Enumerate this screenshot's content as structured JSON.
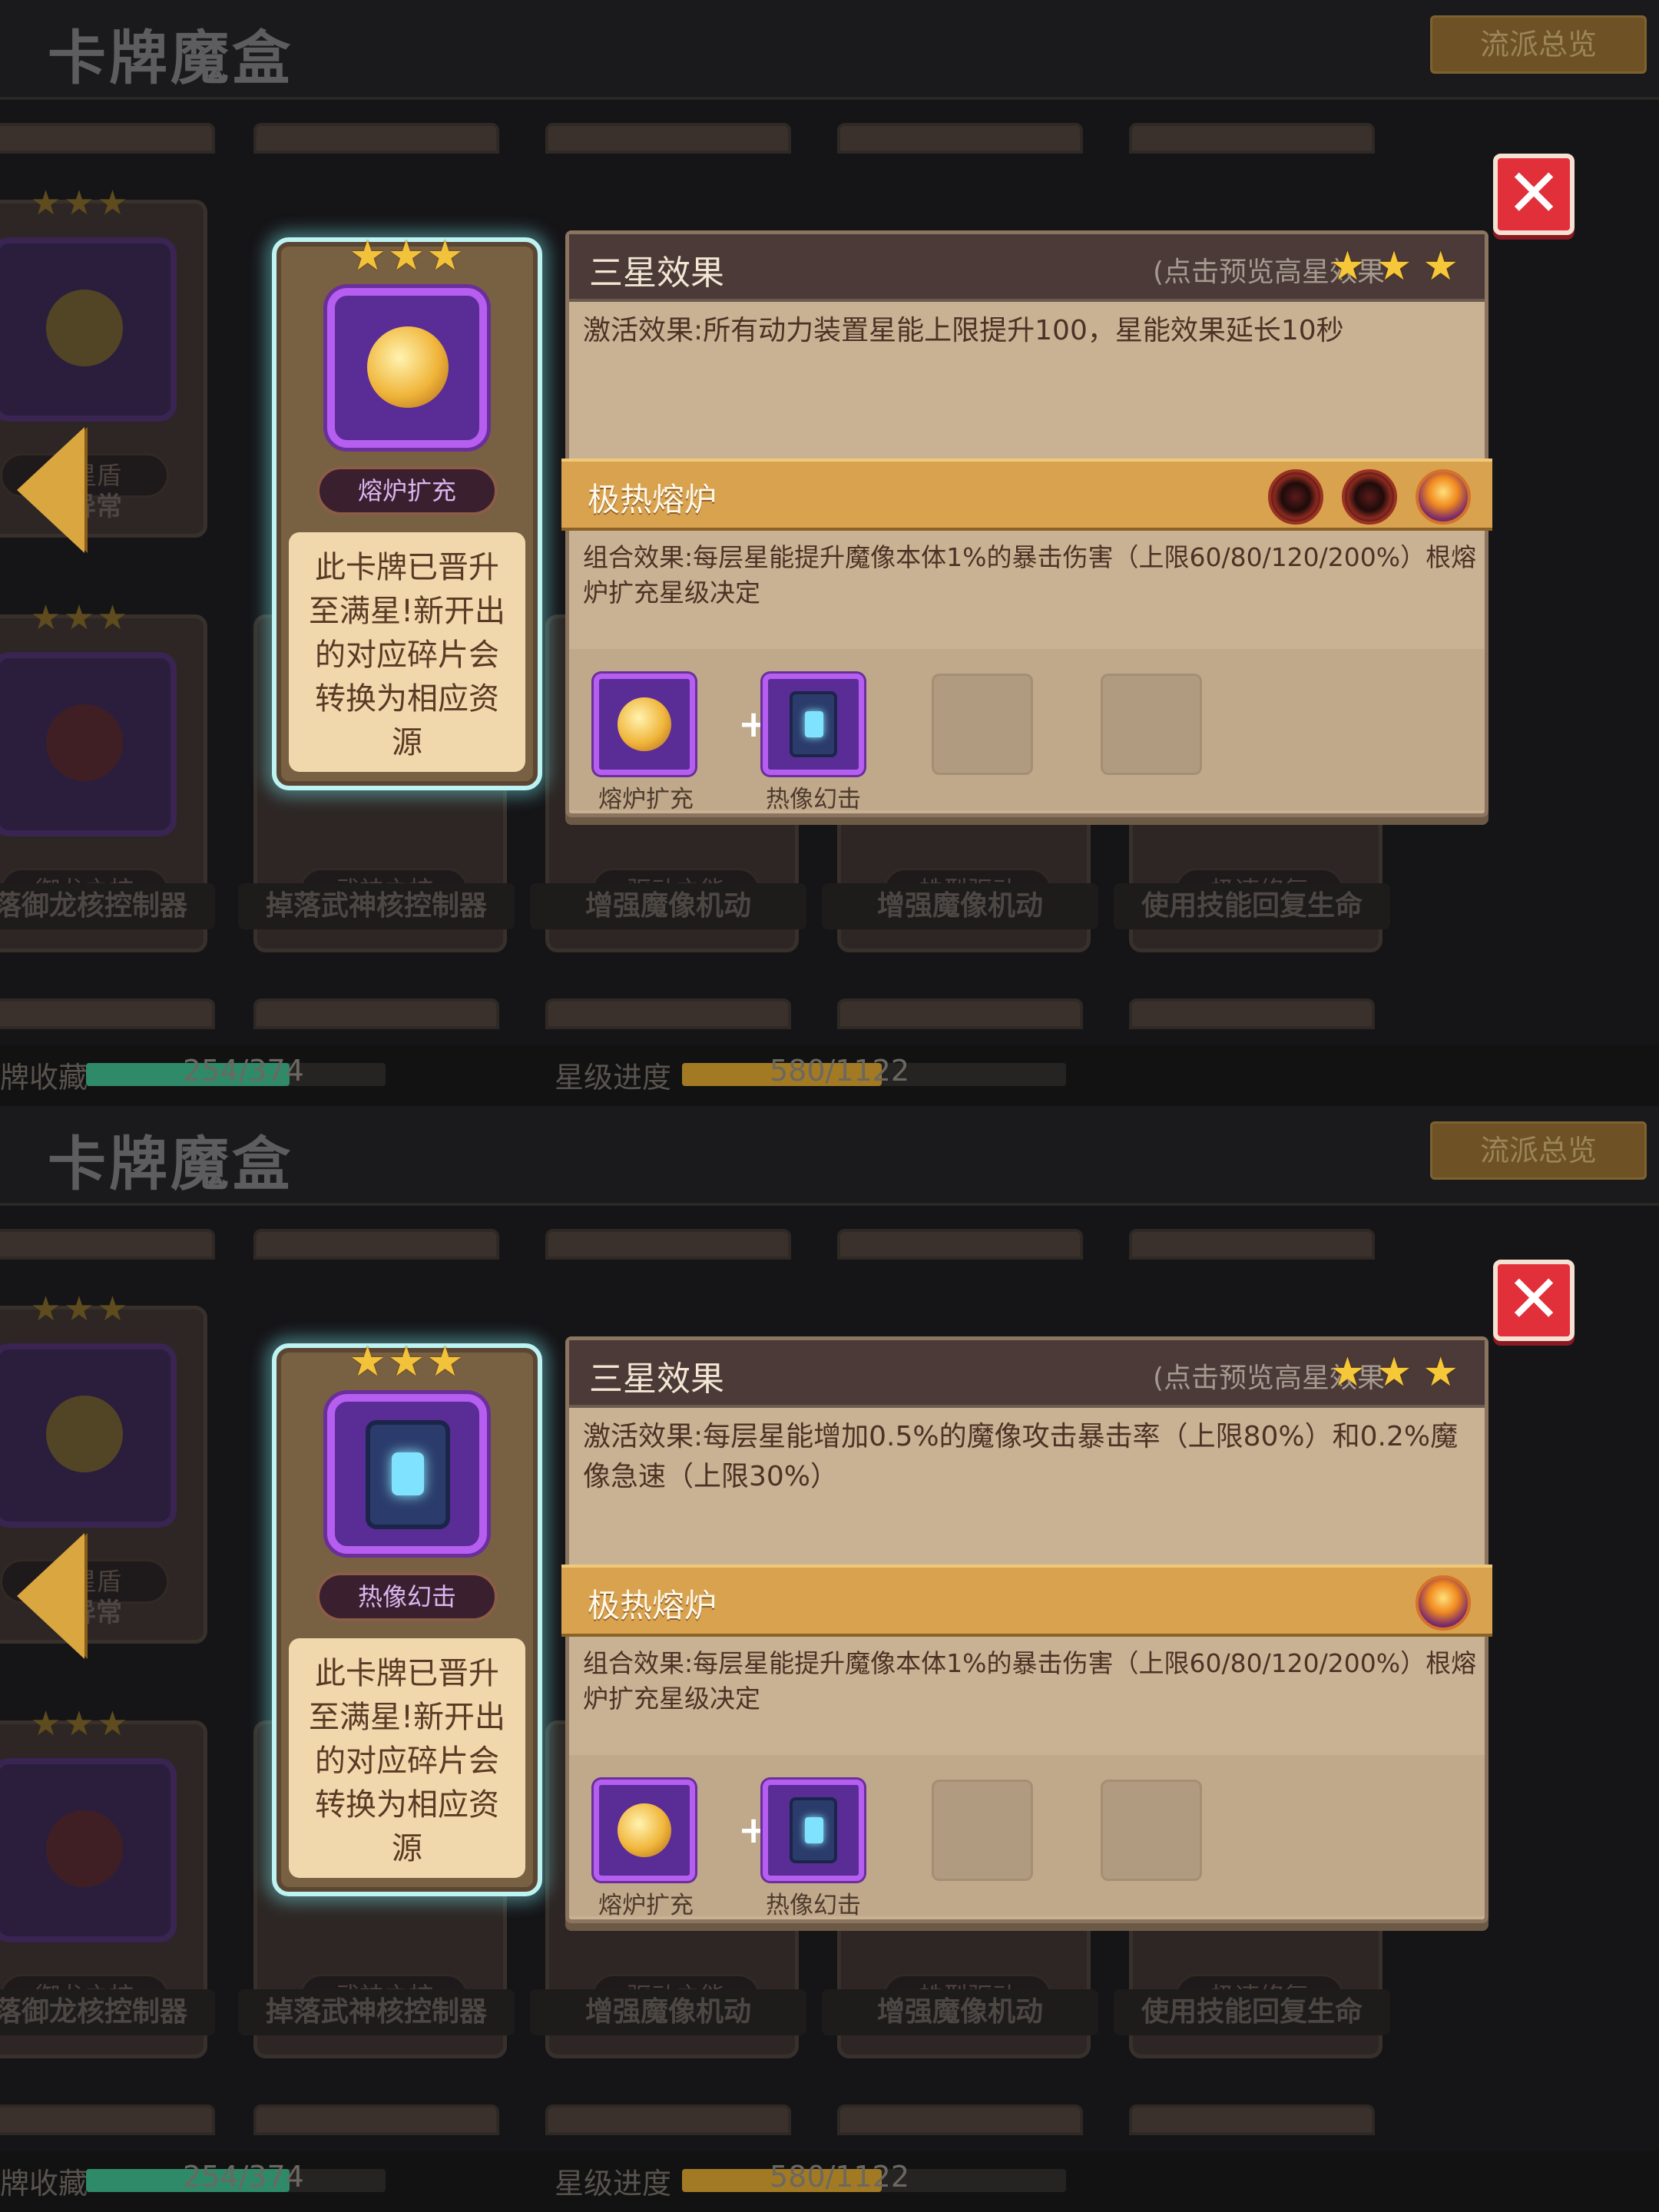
{
  "screens": [
    {
      "title": "卡牌魔盒",
      "overview_button": "流派总览",
      "grid": {
        "top_row_tags": [
          "元星盾",
          "异常"
        ],
        "card_tags": [
          "御龙之核",
          "武神之核",
          "驱动之能",
          "蛛型驱动",
          "极速修复"
        ],
        "card_names": [
          "掉落御龙核控制器",
          "掉落武神核控制器",
          "增强魔像机动",
          "增强魔像机动",
          "使用技能回复生命"
        ],
        "partial_name": "元星盾",
        "partial_name_2": "异常"
      },
      "selected_card": {
        "stars": "★★★",
        "tag": "熔炉扩充",
        "icon": "furnace-orb-icon",
        "description": "此卡牌已晋升至满星!新开出的对应碎片会转换为相应资源"
      },
      "panel": {
        "title": "三星效果",
        "hint": "(点击预览高星效果",
        "stars": "★★★",
        "effect": "激活效果:所有动力装置星能上限提升100，星能效果延长10秒",
        "set_name": "极热熔炉",
        "set_icons": [
          "dark-gear-icon",
          "dark-gear-icon",
          "furnace-core-icon"
        ],
        "combo": "组合效果:每层星能提升魔像本体1%的暴击伤害（上限60/80/120/200%）根熔炉扩充星级决定",
        "slots": [
          {
            "label": "熔炉扩充",
            "icon": "furnace-orb-icon"
          },
          {
            "label": "热像幻击",
            "icon": "lantern-icon"
          }
        ]
      },
      "footer": {
        "collection_label": "牌收藏",
        "collection_value": "254/374",
        "collection_progress": 0.68,
        "star_label": "星级进度",
        "star_value": "580/1122",
        "star_progress": 0.52
      }
    },
    {
      "title": "卡牌魔盒",
      "overview_button": "流派总览",
      "grid": {
        "top_row_tags": [
          "元星盾",
          "异常"
        ],
        "card_tags": [
          "御龙之核",
          "武神之核",
          "驱动之能",
          "蛛型驱动",
          "极速修复"
        ],
        "card_names": [
          "掉落御龙核控制器",
          "掉落武神核控制器",
          "增强魔像机动",
          "增强魔像机动",
          "使用技能回复生命"
        ],
        "partial_name": "元星盾",
        "partial_name_2": "异常"
      },
      "selected_card": {
        "stars": "★★★",
        "tag": "热像幻击",
        "icon": "lantern-icon",
        "description": "此卡牌已晋升至满星!新开出的对应碎片会转换为相应资源"
      },
      "panel": {
        "title": "三星效果",
        "hint": "(点击预览高星效果",
        "stars": "★★★",
        "effect": "激活效果:每层星能增加0.5%的魔像攻击暴击率（上限80%）和0.2%魔像急速（上限30%）",
        "set_name": "极热熔炉",
        "set_icons": [
          "furnace-core-icon"
        ],
        "combo": "组合效果:每层星能提升魔像本体1%的暴击伤害（上限60/80/120/200%）根熔炉扩充星级决定",
        "slots": [
          {
            "label": "熔炉扩充",
            "icon": "furnace-orb-icon"
          },
          {
            "label": "热像幻击",
            "icon": "lantern-icon"
          }
        ]
      },
      "footer": {
        "collection_label": "牌收藏",
        "collection_value": "254/374",
        "collection_progress": 0.68,
        "star_label": "星级进度",
        "star_value": "580/1122",
        "star_progress": 0.52
      }
    }
  ],
  "colors": {
    "accent_gold": "#d8a24f",
    "panel_header": "#4b3a37",
    "selection_glow": "#bdf3f3",
    "close_red": "#e1303a",
    "collection_fill": "#2f8a6a",
    "star_fill": "#a37a24"
  }
}
